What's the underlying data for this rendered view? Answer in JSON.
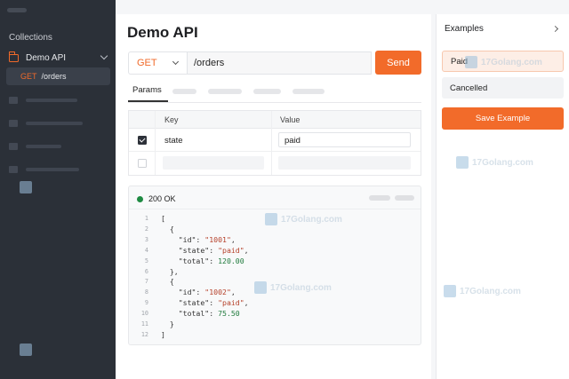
{
  "sidebar": {
    "section_title": "Collections",
    "collection": {
      "name": "Demo API",
      "icon": "folder-icon"
    },
    "request": {
      "method": "GET",
      "path": "/orders"
    }
  },
  "main": {
    "title": "Demo API",
    "request": {
      "method": "GET",
      "url": "/orders",
      "send_label": "Send"
    },
    "tabs": {
      "active": "Params"
    },
    "params": {
      "headers": {
        "key": "Key",
        "value": "Value"
      },
      "rows": [
        {
          "enabled": true,
          "key": "state",
          "value": "paid"
        }
      ]
    },
    "response": {
      "status": "200 OK",
      "lines": [
        [
          "1",
          "["
        ],
        [
          "2",
          "  {"
        ],
        [
          "3",
          "    \"id\": \"1001\","
        ],
        [
          "4",
          "    \"state\": \"paid\","
        ],
        [
          "5",
          "    \"total\": 120.00"
        ],
        [
          "6",
          "  },"
        ],
        [
          "7",
          "  {"
        ],
        [
          "8",
          "    \"id\": \"1002\","
        ],
        [
          "9",
          "    \"state\": \"paid\","
        ],
        [
          "10",
          "    \"total\": 75.50"
        ],
        [
          "11",
          "  }"
        ],
        [
          "12",
          "]"
        ]
      ]
    }
  },
  "examples": {
    "title": "Examples",
    "items": [
      "Paid",
      "Cancelled"
    ],
    "save_label": "Save Example"
  },
  "watermark": {
    "text": "17Golang.com"
  },
  "colors": {
    "accent": "#f26b2a",
    "sidebar_bg": "#2b3038",
    "status_ok": "#1e8a42"
  }
}
